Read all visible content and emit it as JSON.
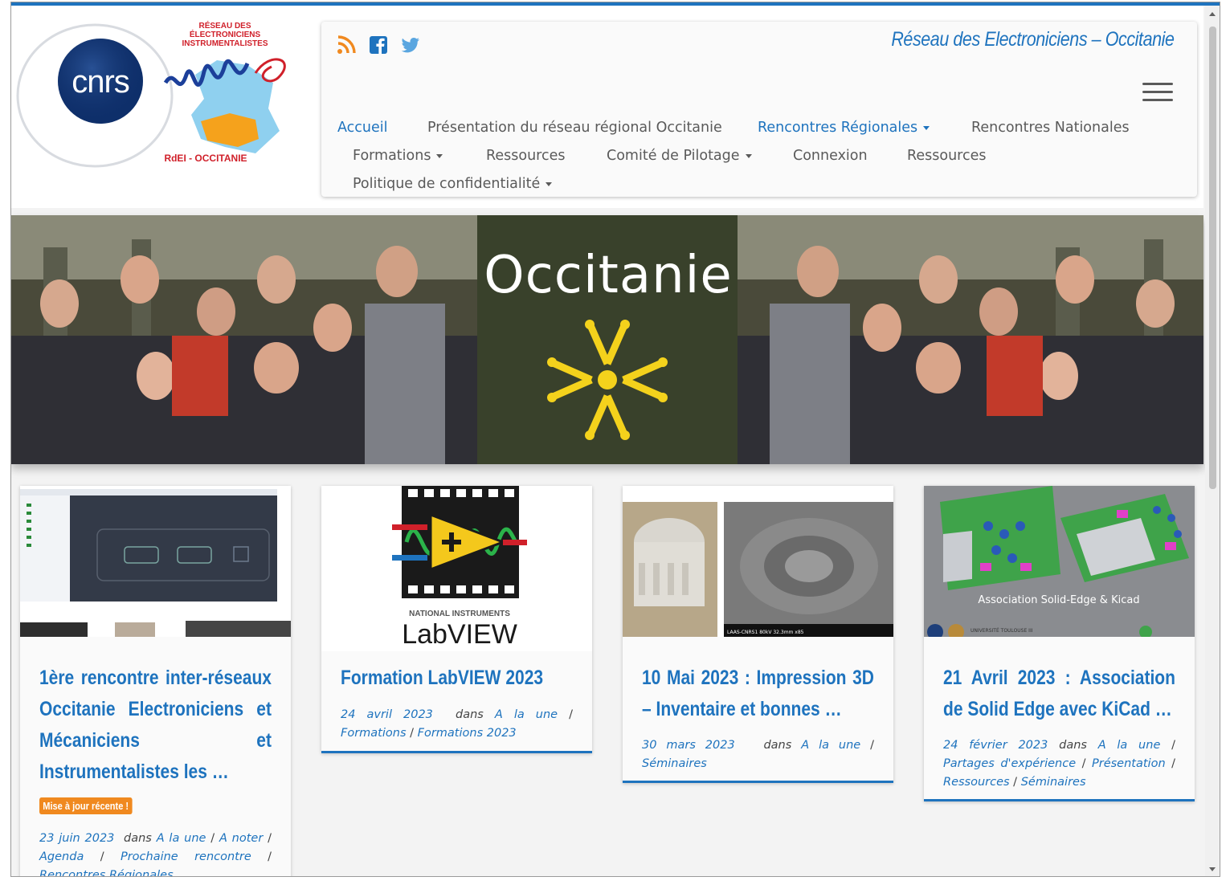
{
  "site": {
    "tagline": "Réseau des Electroniciens – Occitanie",
    "logo_cnrs_text": "cnrs",
    "logo_network_lines": [
      "RÉSEAU DES",
      "ÉLECTRONICIENS",
      "INSTRUMENTALISTES"
    ],
    "logo_network_caption": "RdEI - OCCITANIE",
    "accent_color": "#1e73be"
  },
  "social": [
    {
      "name": "rss-icon",
      "color": "#f0891f"
    },
    {
      "name": "facebook-icon",
      "color": "#1e73be"
    },
    {
      "name": "twitter-icon",
      "color": "#5aa6e0"
    }
  ],
  "menu": {
    "items": [
      {
        "label": "Accueil",
        "active": true,
        "dropdown": false
      },
      {
        "label": "Présentation du réseau régional Occitanie",
        "active": false,
        "dropdown": false
      },
      {
        "label": "Rencontres Régionales",
        "active": true,
        "dropdown": true
      },
      {
        "label": "Rencontres Nationales",
        "active": false,
        "dropdown": false
      },
      {
        "label": "Formations",
        "active": false,
        "dropdown": true
      },
      {
        "label": "Ressources",
        "active": false,
        "dropdown": false
      },
      {
        "label": "Comité de Pilotage",
        "active": false,
        "dropdown": true
      },
      {
        "label": "Connexion",
        "active": false,
        "dropdown": false
      },
      {
        "label": "Ressources",
        "active": false,
        "dropdown": false
      },
      {
        "label": "Politique de confidentialité",
        "active": false,
        "dropdown": true
      }
    ]
  },
  "hero": {
    "word": "Occitanie"
  },
  "posts": [
    {
      "title": "1ère rencontre inter-réseaux Occitanie Electroniciens et Mécaniciens et Instrumentalistes les …",
      "badge": "Mise à jour récente !",
      "date": "23 juin 2023",
      "dans": "dans",
      "categories": [
        "A la une",
        "A noter",
        "Agenda",
        "Prochaine rencontre",
        "Rencontres Régionales"
      ]
    },
    {
      "title": "Formation LabVIEW 2023",
      "thumb_brand_top": "NATIONAL INSTRUMENTS",
      "thumb_brand": "LabVIEW",
      "date": "24 avril 2023",
      "dans": "dans",
      "categories": [
        "A la une",
        "Formations",
        "Formations 2023"
      ]
    },
    {
      "title": "10 Mai 2023 : Impression 3D – Inventaire et bonnes …",
      "thumb_caption": "LAAS-CNRS1  80kV  32.3mm  x85",
      "date": "30 mars 2023",
      "dans": "dans",
      "categories": [
        "A la une",
        "Séminaires"
      ]
    },
    {
      "title": "21 Avril 2023 : Association de Solid Edge avec KiCad …",
      "thumb_caption": "Association Solid-Edge & Kicad",
      "thumb_footer": "UNIVERSITÉ TOULOUSE III",
      "date": "24 février 2023",
      "dans": "dans",
      "categories": [
        "A la une",
        "Partages d'expérience",
        "Présentation",
        "Ressources",
        "Séminaires"
      ]
    }
  ]
}
